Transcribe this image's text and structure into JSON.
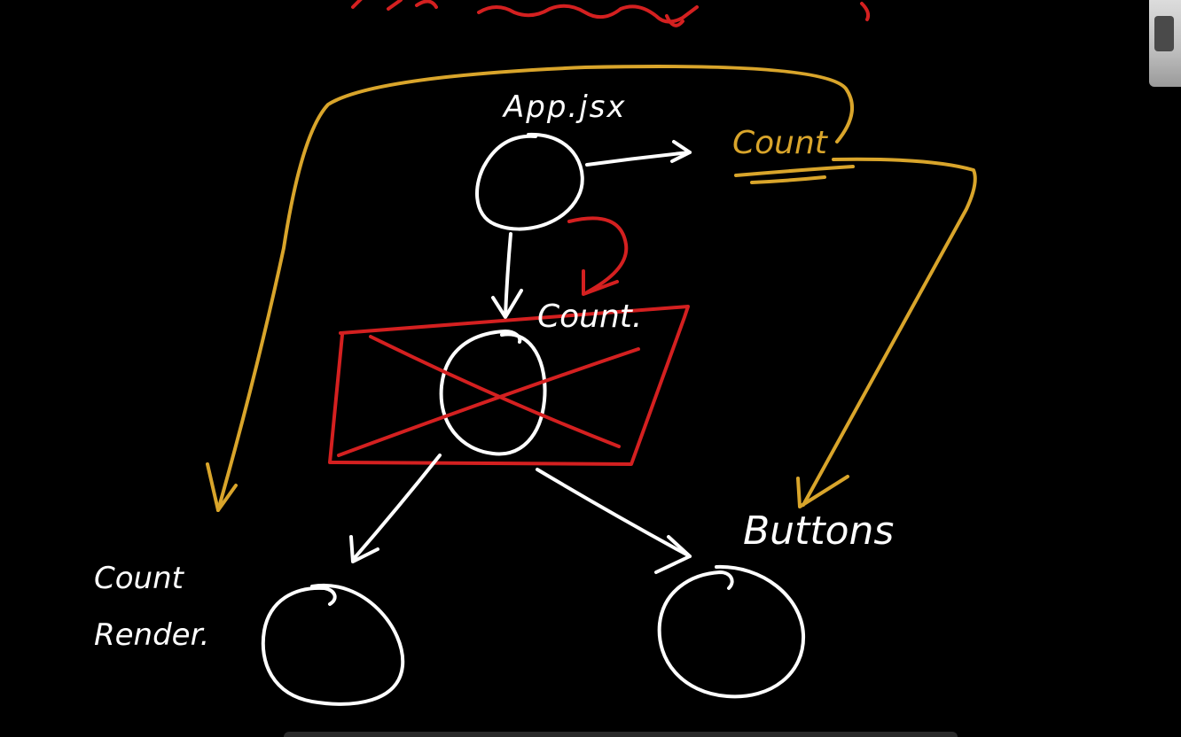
{
  "labels": {
    "app": "App.jsx",
    "count_state": "Count",
    "count_crossed": "Count.",
    "count_render_line1": "Count",
    "count_render_line2": "Render.",
    "buttons": "Buttons"
  },
  "colors": {
    "background": "#000000",
    "white": "#ffffff",
    "yellow": "#d9a52b",
    "red": "#d42020"
  }
}
